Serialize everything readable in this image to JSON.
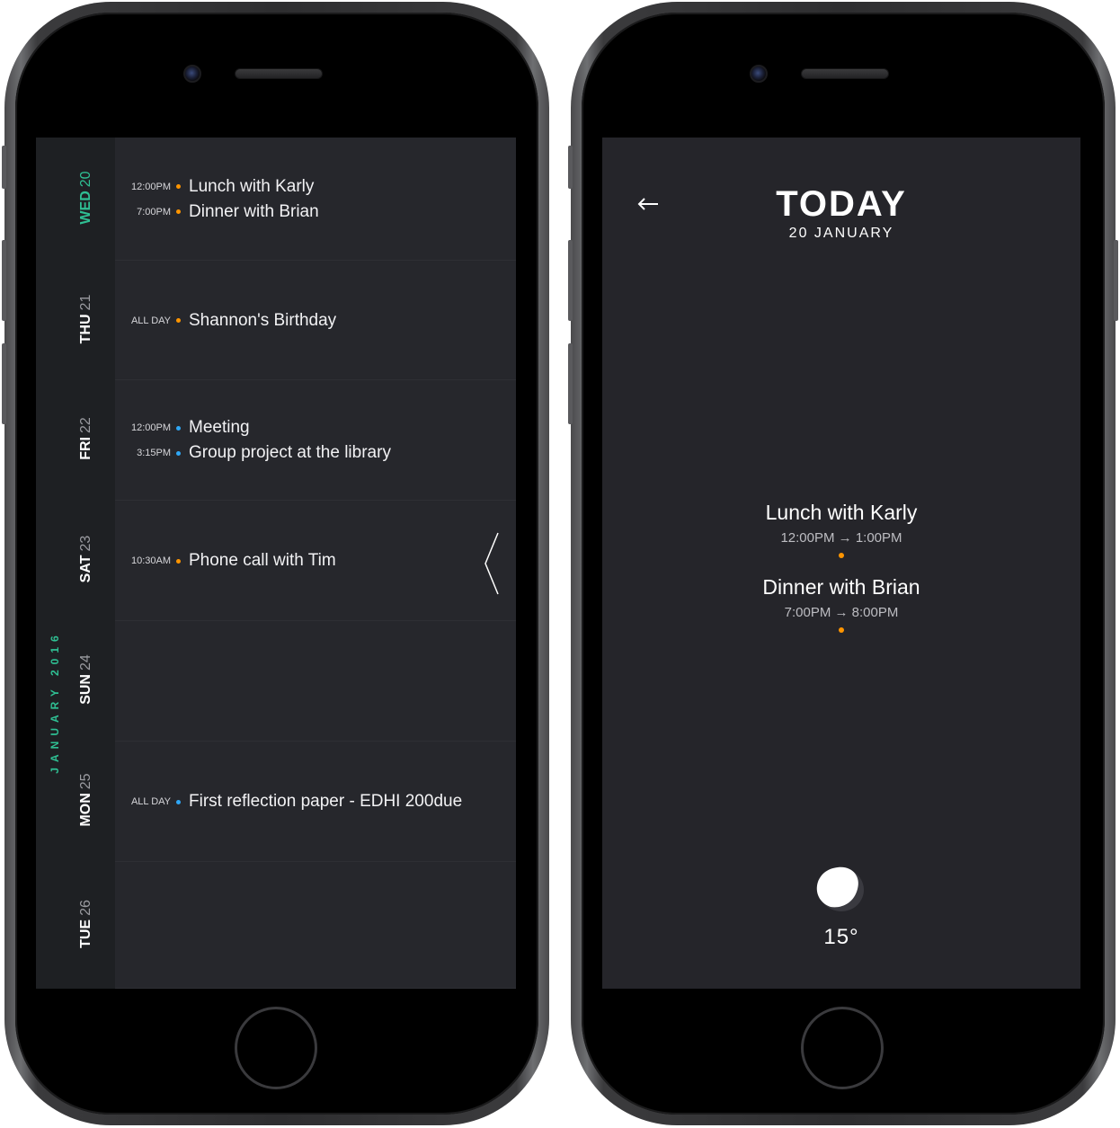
{
  "calendar": {
    "month_label": "JANUARY 2016",
    "days": [
      {
        "dow": "WED",
        "num": "20",
        "today": true,
        "events": [
          {
            "time": "12:00PM",
            "title": "Lunch with Karly",
            "color": "#ff9500"
          },
          {
            "time": "7:00PM",
            "title": "Dinner with Brian",
            "color": "#ff9500"
          }
        ]
      },
      {
        "dow": "THU",
        "num": "21",
        "events": [
          {
            "time": "ALL DAY",
            "title": "Shannon's Birthday",
            "color": "#ff9500"
          }
        ]
      },
      {
        "dow": "FRI",
        "num": "22",
        "events": [
          {
            "time": "12:00PM",
            "title": "Meeting",
            "color": "#2fa7f5"
          },
          {
            "time": "3:15PM",
            "title": "Group project at the library",
            "color": "#2fa7f5"
          }
        ]
      },
      {
        "dow": "SAT",
        "num": "23",
        "events": [
          {
            "time": "10:30AM",
            "title": "Phone call with Tim",
            "color": "#ff9500"
          }
        ]
      },
      {
        "dow": "SUN",
        "num": "24",
        "events": []
      },
      {
        "dow": "MON",
        "num": "25",
        "events": [
          {
            "time": "ALL DAY",
            "title": "First reflection paper - EDHI 200due",
            "color": "#2fa7f5"
          }
        ]
      },
      {
        "dow": "TUE",
        "num": "26",
        "events": []
      }
    ]
  },
  "today_view": {
    "title": "TODAY",
    "date": "20 JANUARY",
    "events": [
      {
        "title": "Lunch with Karly",
        "time": "12:00PM → 1:00PM",
        "color": "#ff9500"
      },
      {
        "title": "Dinner with Brian",
        "time": "7:00PM → 8:00PM",
        "color": "#ff9500"
      }
    ],
    "weather_icon": "moon-icon",
    "temperature": "15°"
  },
  "colors": {
    "accent_green": "#2fbf93",
    "dot_orange": "#ff9500",
    "dot_blue": "#2fa7f5",
    "screen_bg": "#25252a"
  },
  "icons": {
    "back": "back-arrow-icon",
    "expand": "chevron-left-icon"
  }
}
